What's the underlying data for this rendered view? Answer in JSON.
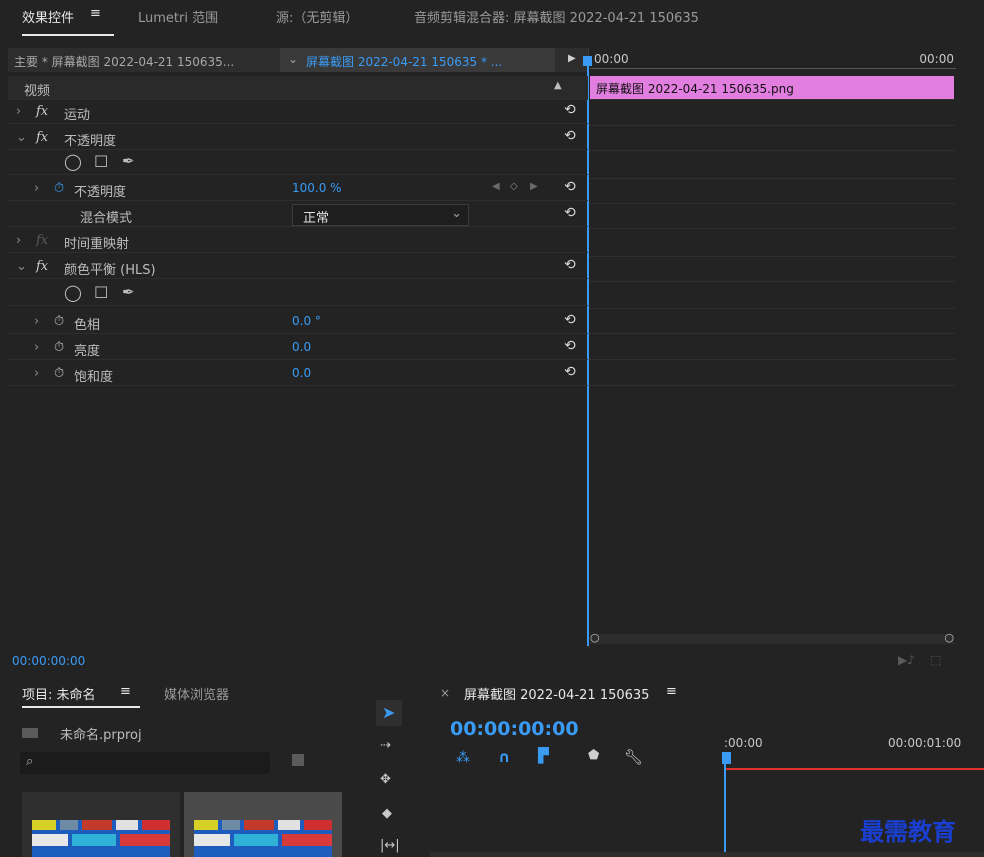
{
  "top_tabs": {
    "effect_controls": "效果控件",
    "menu_icon": "≡",
    "lumetri": "Lumetri 范围",
    "source": "源:（无剪辑）",
    "audio_mixer": "音频剪辑混合器: 屏幕截图 2022-04-21 150635"
  },
  "ec_header": {
    "master": "主要 * 屏幕截图 2022-04-21 150635...",
    "clip_selector": "屏幕截图 2022-04-21 150635 * ...",
    "tl_start": "00:00",
    "tl_end": "00:00",
    "clip_name": "屏幕截图 2022-04-21 150635.png"
  },
  "ec_rows": {
    "video": "视频",
    "motion": "运动",
    "opacity_group": "不透明度",
    "opacity_param": "不透明度",
    "opacity_value": "100.0 %",
    "blend_label": "混合模式",
    "blend_value": "正常",
    "time_remap": "时间重映射",
    "color_balance": "颜色平衡 (HLS)",
    "hue": "色相",
    "hue_value": "0.0 °",
    "lightness": "亮度",
    "lightness_value": "0.0",
    "saturation": "饱和度",
    "saturation_value": "0.0",
    "fx_label": "fx"
  },
  "ec_footer": {
    "timecode": "00:00:00:00"
  },
  "project_panel": {
    "tab_project": "项目: 未命名",
    "menu_icon": "≡",
    "tab_media": "媒体浏览器",
    "file_name": "未命名.prproj",
    "search_placeholder": ""
  },
  "sequence_panel": {
    "close": "×",
    "title": "屏幕截图 2022-04-21 150635",
    "menu_icon": "≡",
    "timecode": "00:00:00:00",
    "ruler_start": ":00:00",
    "ruler_end": "00:00:01:00"
  },
  "watermark": "最需教育",
  "colors": {
    "accent_blue": "#3a9bf5",
    "clip_pink": "#e27ee0",
    "playhead_red": "#e0322a"
  }
}
